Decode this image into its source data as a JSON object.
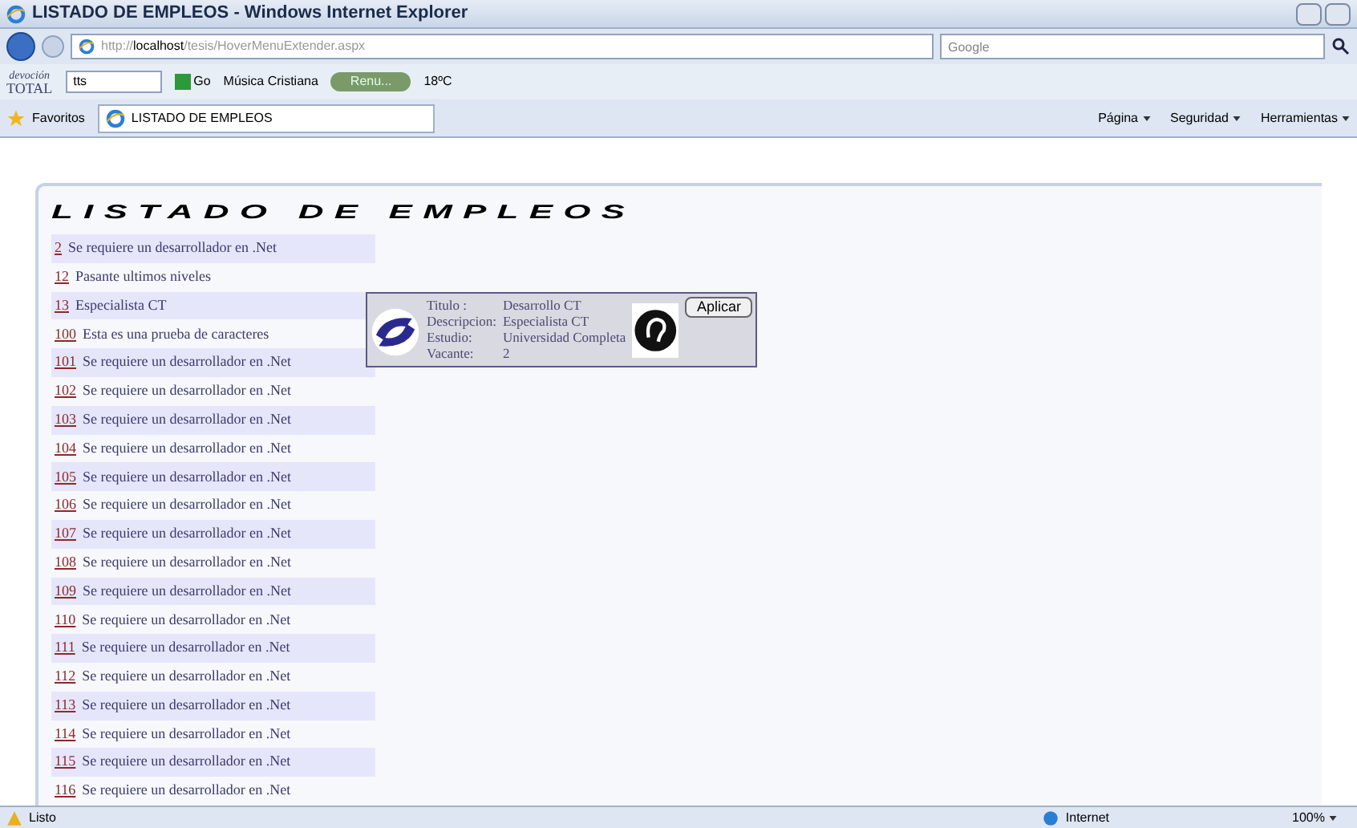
{
  "window": {
    "title": "LISTADO DE EMPLEOS - Windows Internet Explorer"
  },
  "address_bar": {
    "url_prefix": "http://",
    "url_host": "localhost",
    "url_path": "/tesis/HoverMenuExtender.aspx",
    "search_placeholder": "Google"
  },
  "toolbar": {
    "logo_top": "devoción",
    "logo_bottom": "TOTAL",
    "search_value": "tts",
    "go": "Go",
    "radio": "Música Cristiana",
    "player": "Renu...",
    "weather": "18ºC"
  },
  "favorites_bar": {
    "favorites": "Favoritos",
    "tab": "LISTADO DE EMPLEOS",
    "commands": [
      "Página",
      "Seguridad",
      "Herramientas"
    ]
  },
  "page": {
    "heading": "LISTADO DE EMPLEOS",
    "rows": [
      {
        "id": "2",
        "text": "Se requiere un desarrollador en .Net"
      },
      {
        "id": "12",
        "text": "Pasante ultimos niveles"
      },
      {
        "id": "13",
        "text": "Especialista CT"
      },
      {
        "id": "100",
        "text": "Esta es una prueba de caracteres"
      },
      {
        "id": "101",
        "text": "Se requiere un desarrollador en .Net"
      },
      {
        "id": "102",
        "text": "Se requiere un desarrollador en .Net"
      },
      {
        "id": "103",
        "text": "Se requiere un desarrollador en .Net"
      },
      {
        "id": "104",
        "text": "Se requiere un desarrollador en .Net"
      },
      {
        "id": "105",
        "text": "Se requiere un desarrollador en .Net"
      },
      {
        "id": "106",
        "text": "Se requiere un desarrollador en .Net"
      },
      {
        "id": "107",
        "text": "Se requiere un desarrollador en .Net"
      },
      {
        "id": "108",
        "text": "Se requiere un desarrollador en .Net"
      },
      {
        "id": "109",
        "text": "Se requiere un desarrollador en .Net"
      },
      {
        "id": "110",
        "text": "Se requiere un desarrollador en .Net"
      },
      {
        "id": "111",
        "text": "Se requiere un desarrollador en .Net"
      },
      {
        "id": "112",
        "text": "Se requiere un desarrollador en .Net"
      },
      {
        "id": "113",
        "text": "Se requiere un desarrollador en .Net"
      },
      {
        "id": "114",
        "text": "Se requiere un desarrollador en .Net"
      },
      {
        "id": "115",
        "text": "Se requiere un desarrollador en .Net"
      },
      {
        "id": "116",
        "text": "Se requiere un desarrollador en .Net"
      }
    ],
    "popup": {
      "fields": [
        {
          "label": "Titulo :",
          "value": "Desarrollo CT"
        },
        {
          "label": "Descripcion:",
          "value": "Especialista CT"
        },
        {
          "label": "Estudio:",
          "value": "Universidad Completa"
        },
        {
          "label": "Vacante:",
          "value": "2"
        }
      ],
      "button": "Aplicar"
    }
  },
  "status_bar": {
    "status": "Listo",
    "zone": "Internet",
    "zoom": "100%"
  }
}
